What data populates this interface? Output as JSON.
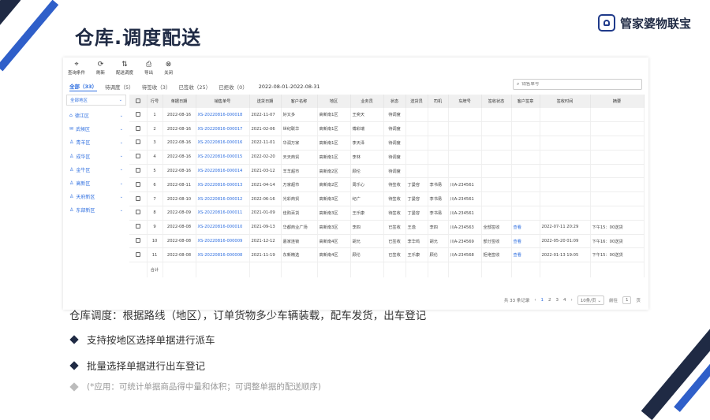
{
  "page_title": "仓库.调度配送",
  "brand": "管家婆物联宝",
  "toolbar": [
    {
      "icon": "⌖",
      "label": "查询条件"
    },
    {
      "icon": "⟳",
      "label": "刷新"
    },
    {
      "icon": "⇅",
      "label": "配送调度"
    },
    {
      "icon": "⎙",
      "label": "导出"
    },
    {
      "icon": "⊗",
      "label": "关闭"
    }
  ],
  "tabs": [
    "全部（33）",
    "待调度（5）",
    "待签收（3）",
    "已签收（25）",
    "已拒收（0）"
  ],
  "date_range": "2022-08-01-2022-08-31",
  "search_placeholder": "销售单号",
  "region_select": "全部地区",
  "regions": [
    "德江区",
    "武候区",
    "青羊区",
    "成华区",
    "金牛区",
    "高新区",
    "天府新区",
    "东部新区"
  ],
  "columns": [
    "",
    "行号",
    "单据日期",
    "销售单号",
    "送货日期",
    "客户名称",
    "地区",
    "业务员",
    "状态",
    "送货员",
    "司机",
    "车牌号",
    "签收状态",
    "客户签章",
    "签收时间",
    "摘要"
  ],
  "rows": [
    [
      "1",
      "2022-08-16",
      "XS-20220816-000018",
      "2022-11-07",
      "好又多",
      "高新南1区",
      "王奕天",
      "待调度",
      "",
      "",
      "",
      "",
      "",
      "",
      ""
    ],
    [
      "2",
      "2022-08-16",
      "XS-20220816-000017",
      "2021-02-06",
      "世纪联华",
      "高新南1区",
      "傅彩瑞",
      "待调度",
      "",
      "",
      "",
      "",
      "",
      "",
      ""
    ],
    [
      "3",
      "2022-08-16",
      "XS-20220816-000016",
      "2022-11-01",
      "华润万家",
      "高新南1区",
      "李天泽",
      "待调度",
      "",
      "",
      "",
      "",
      "",
      "",
      ""
    ],
    [
      "4",
      "2022-08-16",
      "XS-20220816-000015",
      "2022-02-20",
      "天天商贸",
      "高新南1区",
      "李林",
      "待调度",
      "",
      "",
      "",
      "",
      "",
      "",
      ""
    ],
    [
      "5",
      "2022-08-16",
      "XS-20220816-000014",
      "2021-03-12",
      "羊羊超市",
      "高新南2区",
      "顾伦",
      "待调度",
      "",
      "",
      "",
      "",
      "",
      "",
      ""
    ],
    [
      "6",
      "2022-08-11",
      "XS-20220816-000013",
      "2021-04-14",
      "万家超市",
      "高新南2区",
      "周乐心",
      "待签收",
      "丁曼容",
      "李书易",
      "川A-234561",
      "",
      "",
      "",
      ""
    ],
    [
      "7",
      "2022-08-10",
      "XS-20220816-000012",
      "2022-06-16",
      "光彩商贸",
      "高新南3区",
      "纪广",
      "待签收",
      "丁曼容",
      "李书易",
      "川A-234561",
      "",
      "",
      "",
      ""
    ],
    [
      "8",
      "2022-08-09",
      "XS-20220816-000011",
      "2021-01-09",
      "佳购百货",
      "高新南3区",
      "王乐康",
      "待签收",
      "丁曼容",
      "李书易",
      "川A-234561",
      "",
      "",
      "",
      ""
    ],
    [
      "9",
      "2022-08-08",
      "XS-20220816-000010",
      "2021-09-13",
      "华都商业广场",
      "高新南3区",
      "李四",
      "已签收",
      "王逸",
      "李四",
      "川A-234563",
      "全部签收",
      "查看",
      "2022-07-11 20:29",
      "下午15：00送货"
    ],
    [
      "10",
      "2022-08-08",
      "XS-20220816-000009",
      "2021-12-12",
      "嘉家连锁",
      "高新南4区",
      "胡允",
      "已签收",
      "李华鸣",
      "胡允",
      "川A-234569",
      "部分签收",
      "查看",
      "2022-05-20 01:09",
      "下午16：00送货"
    ],
    [
      "11",
      "2022-08-08",
      "XS-20220816-000008",
      "2021-11-19",
      "东新精选",
      "高新南4区",
      "顾伦",
      "已签收",
      "王乐康",
      "顾伦",
      "川A-234568",
      "拒绝签收",
      "查看",
      "2022-01-13 19:05",
      "下午15：00送货"
    ]
  ],
  "total_label": "合计",
  "pager": {
    "total": "共 33 条记录",
    "pages": [
      "1",
      "2",
      "3",
      "4"
    ],
    "page_size": "10条/页",
    "goto_label": "前往",
    "goto_value": "1",
    "page_suffix": "页"
  },
  "caption": "仓库调度：根据路线（地区），订单货物多少车辆装载，配车发货，出车登记",
  "bullets": [
    "支持按地区选择单据进行派车",
    "批量选择单据进行出车登记"
  ],
  "note": "(*应用：可统计单据商品得中量和体积；可调整单据的配送顺序)",
  "colors": {
    "accent": "#2f6fe0",
    "dark_navy": "#1f2a44",
    "brand_blue": "#2f5fc9"
  }
}
